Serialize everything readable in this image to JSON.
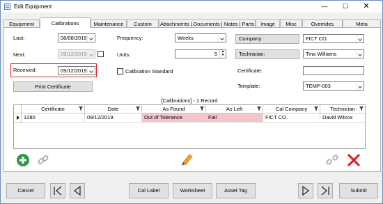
{
  "window": {
    "title": "Edit Equipment"
  },
  "tabs": [
    "Equipment",
    "Calibrations",
    "Maintenance",
    "Custom",
    "Attachments | Documents | Notes | Parts",
    "Image",
    "Misc",
    "Overrides",
    "Meta"
  ],
  "form": {
    "last_label": "Last:",
    "last_value": "08/08/2019",
    "next_label": "Next:",
    "next_value": "09/12/2019",
    "received_label": "Received:",
    "received_value": "09/12/2019",
    "print_certificate": "Print Certificate",
    "frequency_label": "Frequency:",
    "frequency_value": "Weeks",
    "units_label": "Units:",
    "units_value": "5",
    "calibration_standard_label": "Calibration Standard",
    "company_label": "Company:",
    "company_value": "FICT CO.",
    "technician_label": "Technician:",
    "technician_value": "Tina Williams",
    "certificate_label": "Certificate:",
    "certificate_value": "",
    "template_label": "Template:",
    "template_value": "TEMP-003"
  },
  "grid": {
    "caption": "[Calibrations] - 1 Record",
    "columns": [
      "Certificate",
      "Date",
      "As Found",
      "As Left",
      "Cal Company",
      "Technician"
    ],
    "rows": [
      [
        "1280",
        "09/12/2019",
        "Out of Tolerance",
        "Fail",
        "FICT CO.",
        "David Wilcox"
      ]
    ]
  },
  "bottom": {
    "cancel": "Cancel",
    "cal_label": "Cal Label",
    "worksheet": "Worksheet",
    "asset_tag": "Asset Tag",
    "submit": "Submit"
  },
  "colors": {
    "highlight": "#d9262c",
    "bad_cell": "#f4c6cc",
    "add_green": "#2e9a43",
    "delete_red": "#d9262c"
  },
  "icons": [
    "app-icon",
    "minimize-icon",
    "maximize-icon",
    "close-icon",
    "filter-icon",
    "add-icon",
    "link-icon",
    "edit-pencil-icon",
    "unlink-icon",
    "delete-x-icon",
    "first-record-icon",
    "previous-record-icon",
    "next-record-icon",
    "last-record-icon"
  ]
}
